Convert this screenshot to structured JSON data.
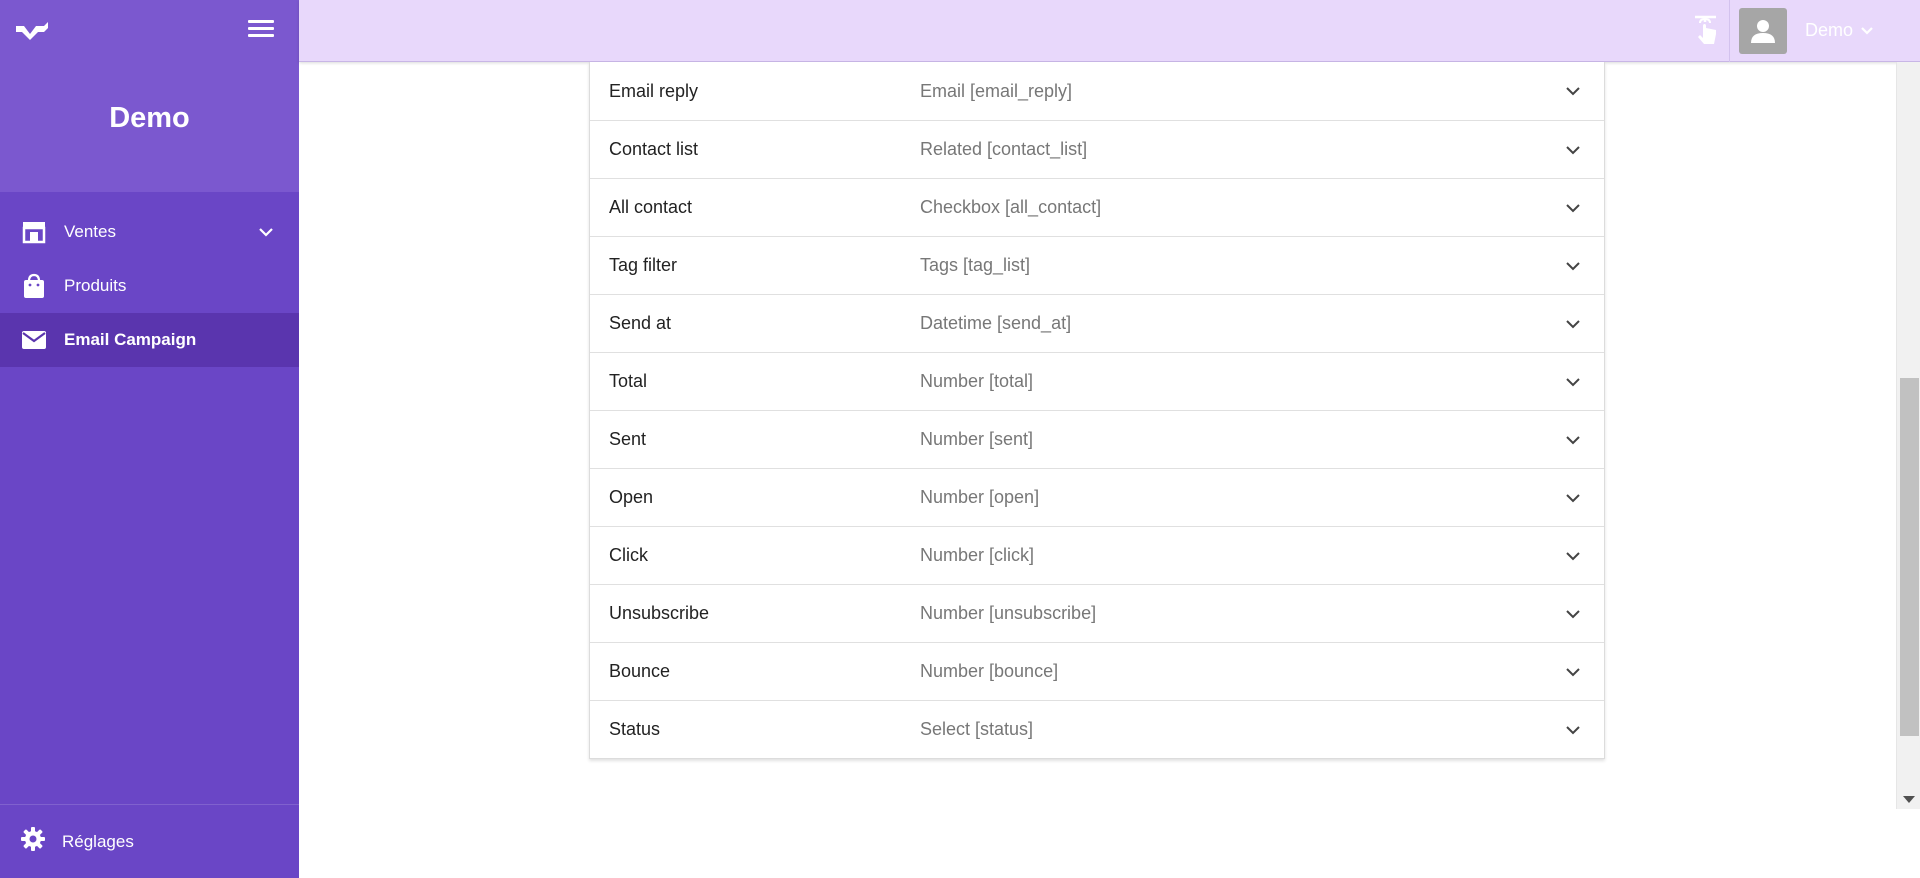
{
  "sidebar": {
    "title": "Demo",
    "items": [
      {
        "label": "Ventes",
        "icon": "store-icon",
        "has_submenu": true
      },
      {
        "label": "Produits",
        "icon": "shopping-bag-icon"
      },
      {
        "label": "Email Campaign",
        "icon": "mail-icon",
        "active": true
      }
    ],
    "settings_label": "Réglages"
  },
  "topbar": {
    "user_name": "Demo"
  },
  "fields": [
    {
      "name": "Email reply",
      "type": "Email [email_reply]"
    },
    {
      "name": "Contact list",
      "type": "Related [contact_list]"
    },
    {
      "name": "All contact",
      "type": "Checkbox [all_contact]"
    },
    {
      "name": "Tag filter",
      "type": "Tags [tag_list]"
    },
    {
      "name": "Send at",
      "type": "Datetime [send_at]"
    },
    {
      "name": "Total",
      "type": "Number [total]"
    },
    {
      "name": "Sent",
      "type": "Number [sent]"
    },
    {
      "name": "Open",
      "type": "Number [open]"
    },
    {
      "name": "Click",
      "type": "Number [click]"
    },
    {
      "name": "Unsubscribe",
      "type": "Number [unsubscribe]"
    },
    {
      "name": "Bounce",
      "type": "Number [bounce]"
    },
    {
      "name": "Status",
      "type": "Select [status]"
    }
  ],
  "colors": {
    "sidebar_bg": "#6a46c6",
    "sidebar_header_bg": "#7b58cf",
    "sidebar_active_bg": "#5a35ae",
    "topbar_bg": "#e8d8fb"
  }
}
